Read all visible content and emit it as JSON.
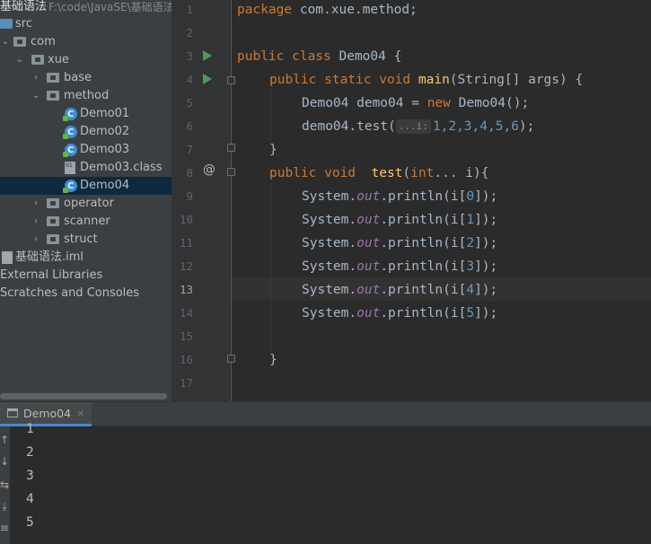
{
  "project": {
    "root_name": "基础语法",
    "root_path": "F:\\code\\JavaSE\\基础语法",
    "items": [
      {
        "label": "src"
      },
      {
        "label": "com"
      },
      {
        "label": "xue"
      },
      {
        "label": "base"
      },
      {
        "label": "method"
      },
      {
        "label": "Demo01"
      },
      {
        "label": "Demo02"
      },
      {
        "label": "Demo03"
      },
      {
        "label": "Demo03.class"
      },
      {
        "label": "Demo04"
      },
      {
        "label": "operator"
      },
      {
        "label": "scanner"
      },
      {
        "label": "struct"
      },
      {
        "label": "基础语法.iml"
      },
      {
        "label": "External Libraries"
      },
      {
        "label": "Scratches and Consoles"
      }
    ]
  },
  "editor": {
    "line_numbers": [
      "1",
      "2",
      "3",
      "4",
      "5",
      "6",
      "7",
      "8",
      "9",
      "10",
      "11",
      "12",
      "13",
      "14",
      "15",
      "16",
      "17"
    ],
    "current_line": "13",
    "code": {
      "l1_kw": "package",
      "l1_rest": " com.xue.method;",
      "l3_kw": "public class",
      "l3_rest": " Demo04 {",
      "l4_kw": "public static void",
      "l4_fn": "main",
      "l4_rest": "(String[] args) {",
      "l5_a": "Demo04 demo04 = ",
      "l5_kw": "new",
      "l5_b": " Demo04();",
      "l6_a": "demo04.test(",
      "l6_hint": "...i:",
      "l6_nums": "1,2,3,4,5,6",
      "l6_b": ");",
      "l7": "}",
      "l8_kw1": "public void",
      "l8_fn": "test",
      "l8_p": "(",
      "l8_kw2": "int",
      "l8_rest": "... i){",
      "println": [
        {
          "idx": "0"
        },
        {
          "idx": "1"
        },
        {
          "idx": "2"
        },
        {
          "idx": "3"
        },
        {
          "idx": "4"
        },
        {
          "idx": "5"
        }
      ],
      "sys": "System.",
      "out": "out",
      "pl": ".println(i[",
      "close": "]);",
      "l16": "}"
    }
  },
  "run": {
    "tab_label": "Demo04",
    "tab_close": "×",
    "output": [
      "1",
      "2",
      "3",
      "4",
      "5"
    ]
  },
  "colors": {
    "keyword": "#cc7832",
    "method": "#ffc66d",
    "number": "#6897bb",
    "static_field": "#9876aa",
    "run_green": "#499c54",
    "selection": "#0d293e"
  }
}
